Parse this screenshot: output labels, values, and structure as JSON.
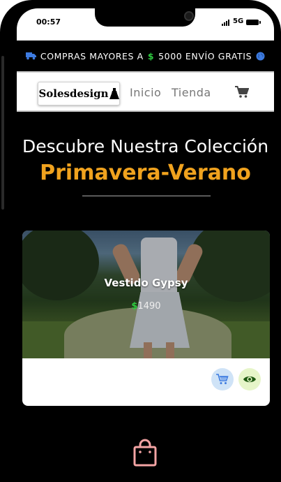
{
  "status_bar": {
    "time": "00:57",
    "network": "5G"
  },
  "promo": {
    "before": "COMPRAS MAYORES A",
    "currency": "$",
    "after": "5000 ENVÍO GRATIS"
  },
  "navbar": {
    "logo": "Solesdesign",
    "links": [
      "Inicio",
      "Tienda"
    ]
  },
  "hero": {
    "title": "Descubre Nuestra Colección",
    "subtitle": "Primavera-Verano"
  },
  "product": {
    "name": "Vestido Gypsy",
    "currency": "$",
    "price": "1490"
  },
  "icons": [
    "truck-icon",
    "globe-icon",
    "dress-icon",
    "cart-icon",
    "view-icon",
    "bag-icon"
  ],
  "colors": {
    "accent": "#f0a21e",
    "price": "#2ecc40",
    "cart_button": "#cfe3f7",
    "view_button": "#e6f5c9",
    "bag": "#f4a4a4"
  }
}
